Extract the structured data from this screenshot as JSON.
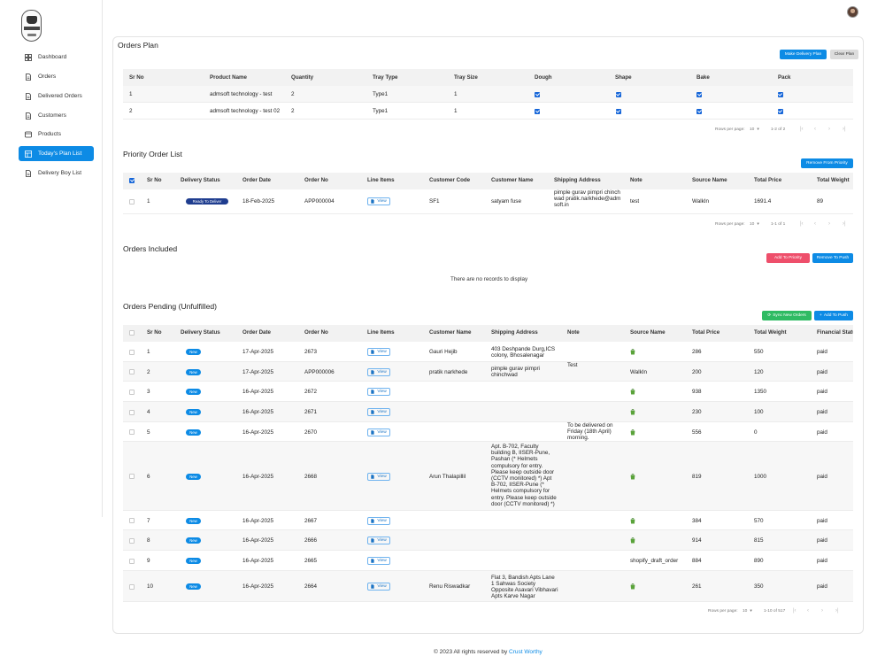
{
  "sidebar": {
    "items": [
      {
        "label": "Dashboard",
        "icon": "dashboard-icon"
      },
      {
        "label": "Orders",
        "icon": "document-icon"
      },
      {
        "label": "Delivered Orders",
        "icon": "document-icon"
      },
      {
        "label": "Customers",
        "icon": "document-icon"
      },
      {
        "label": "Products",
        "icon": "box-icon"
      },
      {
        "label": "Today's Plan List",
        "icon": "grid-icon",
        "active": true
      },
      {
        "label": "Delivery Boy List",
        "icon": "document-icon"
      }
    ]
  },
  "orders_plan": {
    "title": "Orders Plan",
    "make_delivery_plan": "Make Delivery Plan",
    "clear_plan": "Clear Plan",
    "columns": [
      "Sr No",
      "Product Name",
      "Quantity",
      "Tray Type",
      "Tray Size",
      "Dough",
      "Shape",
      "Bake",
      "Pack"
    ],
    "rows": [
      {
        "sr": "1",
        "product": "admsoft technology - test",
        "qty": "2",
        "tray_type": "Type1",
        "tray_size": "1",
        "dough": true,
        "shape": true,
        "bake": true,
        "pack": true
      },
      {
        "sr": "2",
        "product": "admsoft technology - test 02",
        "qty": "2",
        "tray_type": "Type1",
        "tray_size": "1",
        "dough": true,
        "shape": true,
        "bake": true,
        "pack": true
      }
    ],
    "pagination": {
      "rows_label": "Rows per page:",
      "rows_value": "10",
      "range": "1-2 of 2"
    }
  },
  "priority": {
    "title": "Priority Order List",
    "remove_button": "Remove From Priority",
    "columns": [
      "Sr No",
      "Delivery Status",
      "Order Date",
      "Order No",
      "Line Items",
      "Customer Code",
      "Customer Name",
      "Shipping Address",
      "Note",
      "Source Name",
      "Total Price",
      "Total Weight"
    ],
    "rows": [
      {
        "sr": "1",
        "status": "Ready To Deliver",
        "date": "18-Feb-2025",
        "order_no": "APP000004",
        "line": "View",
        "code": "SF1",
        "customer": "satyam fuse",
        "address": "pimple gurav pimpri chinchwad pratik.narkhede@admsoft.in",
        "note": "test",
        "source": "WalkIn",
        "price": "1691.4",
        "weight": "89"
      }
    ],
    "pagination": {
      "rows_label": "Rows per page:",
      "rows_value": "10",
      "range": "1-1 of 1"
    }
  },
  "included": {
    "title": "Orders Included",
    "add_priority": "Add To Priority",
    "remove_push": "Remove To Push",
    "empty": "There are no records to display"
  },
  "pending": {
    "title": "Orders Pending (Unfulfilled)",
    "sync_button": "Sync New Orders",
    "add_push": "Add To Push",
    "columns": [
      "Sr No",
      "Delivery Status",
      "Order Date",
      "Order No",
      "Line Items",
      "Customer Name",
      "Shipping Address",
      "Note",
      "Source Name",
      "Total Price",
      "Total Weight",
      "Financial Status"
    ],
    "rows": [
      {
        "sr": "1",
        "status": "New",
        "date": "17-Apr-2025",
        "order_no": "2673",
        "customer": "Gauri Hejib",
        "address": "403 Deshpande Durg,ICS colony, Bhosalenagar",
        "note": "",
        "source": "shopify-icon",
        "price": "286",
        "weight": "550",
        "fin": "paid"
      },
      {
        "sr": "2",
        "status": "New",
        "date": "17-Apr-2025",
        "order_no": "APP000006",
        "customer": "pratik narkhede",
        "address": "pimple gurav pimpri chinchwad",
        "note": "Test",
        "source": "WalkIn",
        "price": "200",
        "weight": "120",
        "fin": "paid"
      },
      {
        "sr": "3",
        "status": "New",
        "date": "16-Apr-2025",
        "order_no": "2672",
        "customer": "",
        "address": "",
        "note": "",
        "source": "shopify-icon",
        "price": "938",
        "weight": "1350",
        "fin": "paid"
      },
      {
        "sr": "4",
        "status": "New",
        "date": "16-Apr-2025",
        "order_no": "2671",
        "customer": "",
        "address": "",
        "note": "",
        "source": "shopify-icon",
        "price": "230",
        "weight": "100",
        "fin": "paid"
      },
      {
        "sr": "5",
        "status": "New",
        "date": "16-Apr-2025",
        "order_no": "2670",
        "customer": "",
        "address": "",
        "note": "To be delivered on Friday (18th April) morning.",
        "source": "shopify-icon",
        "price": "556",
        "weight": "0",
        "fin": "paid"
      },
      {
        "sr": "6",
        "status": "New",
        "date": "16-Apr-2025",
        "order_no": "2668",
        "customer": "Arun Thalapillil",
        "address": "Apt. B-702, Faculty building B, IISER-Pune, Pashan (* Helmets compulsory for entry. Please keep outside door (CCTV monitored) *) Apt B-702, IISER-Pune (* Helmets compulsory for entry. Please keep outside door (CCTV monitored) *)",
        "note": "",
        "source": "shopify-icon",
        "price": "819",
        "weight": "1000",
        "fin": "paid"
      },
      {
        "sr": "7",
        "status": "New",
        "date": "16-Apr-2025",
        "order_no": "2667",
        "customer": "",
        "address": "",
        "note": "",
        "source": "shopify-icon",
        "price": "384",
        "weight": "570",
        "fin": "paid"
      },
      {
        "sr": "8",
        "status": "New",
        "date": "16-Apr-2025",
        "order_no": "2666",
        "customer": "",
        "address": "",
        "note": "",
        "source": "shopify-icon",
        "price": "914",
        "weight": "815",
        "fin": "paid"
      },
      {
        "sr": "9",
        "status": "New",
        "date": "16-Apr-2025",
        "order_no": "2665",
        "customer": "",
        "address": "",
        "note": "",
        "source": "shopify_draft_order",
        "price": "884",
        "weight": "890",
        "fin": "paid"
      },
      {
        "sr": "10",
        "status": "New",
        "date": "16-Apr-2025",
        "order_no": "2664",
        "customer": "Renu Riswadkar",
        "address": "Flat 3, Bandish Apts Lane 1 Sahwas Society Opposite Asavari Vibhavari Apts Karve Nagar",
        "note": "",
        "source": "shopify-icon",
        "price": "261",
        "weight": "350",
        "fin": "paid"
      }
    ],
    "line_label": "View",
    "pagination": {
      "rows_label": "Rows per page:",
      "rows_value": "10",
      "range": "1-10 of 517"
    }
  },
  "footer": {
    "text": "© 2023 All rights reserved by ",
    "link": "Crust Worthy"
  },
  "colors": {
    "accent": "#0d8be5",
    "danger": "#ee4f6b",
    "success": "#2fbb63",
    "badge_ready": "#1f3d8f"
  }
}
